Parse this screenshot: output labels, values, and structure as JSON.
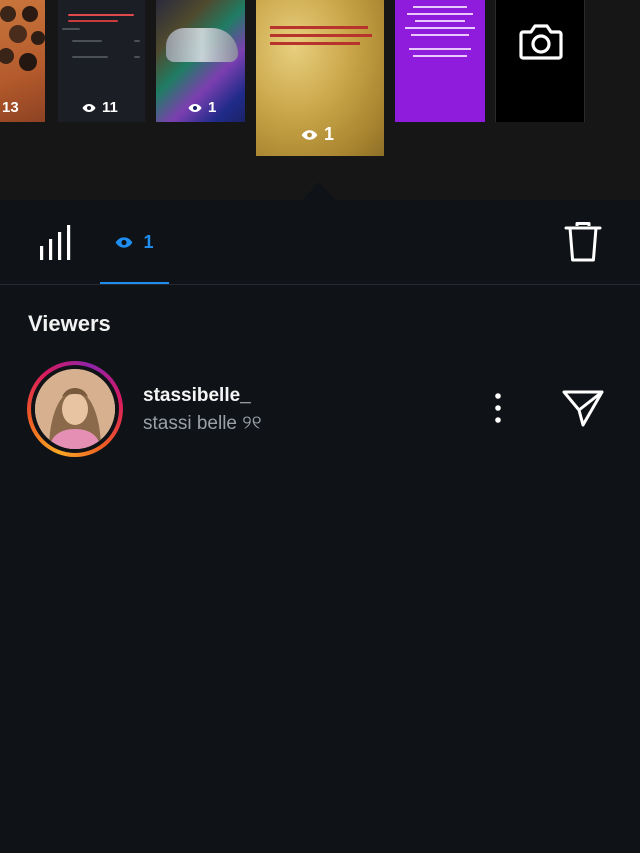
{
  "stories": [
    {
      "id": "story-1",
      "views": "13"
    },
    {
      "id": "story-2",
      "views": "11"
    },
    {
      "id": "story-3",
      "views": "1"
    },
    {
      "id": "story-4",
      "views": "1",
      "selected": true
    },
    {
      "id": "story-5"
    },
    {
      "id": "story-6",
      "icon": "camera-icon"
    }
  ],
  "tabs": {
    "insights_icon": "bar-chart-icon",
    "viewers_icon": "eye-icon",
    "viewers_count": "1",
    "delete_icon": "trash-icon"
  },
  "viewers": {
    "title": "Viewers",
    "list": [
      {
        "username": "stassibelle_",
        "full_name": "stassi belle ୨୧",
        "more_icon": "more-vertical-icon",
        "send_icon": "send-icon"
      }
    ]
  },
  "colors": {
    "background": "#0f1216",
    "accent": "#1f8ef1",
    "secondary_text": "#9aa0a6",
    "story_ring": [
      "#f9a825",
      "#ee5a24",
      "#d81b60",
      "#8e24aa"
    ]
  }
}
